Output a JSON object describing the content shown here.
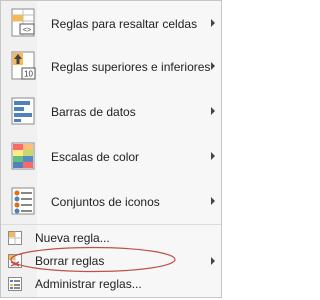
{
  "menu": {
    "items": [
      {
        "label": "Reglas para resaltar celdas",
        "icon": "highlight-cells-rules-icon",
        "has_submenu": true
      },
      {
        "label": "Reglas superiores e inferiores",
        "icon": "top-bottom-rules-icon",
        "has_submenu": true
      },
      {
        "label": "Barras de datos",
        "icon": "data-bars-icon",
        "has_submenu": true
      },
      {
        "label": "Escalas de color",
        "icon": "color-scales-icon",
        "has_submenu": true
      },
      {
        "label": "Conjuntos de iconos",
        "icon": "icon-sets-icon",
        "has_submenu": true
      }
    ],
    "commands": [
      {
        "label": "Nueva regla...",
        "icon": "new-rule-icon",
        "has_submenu": false
      },
      {
        "label": "Borrar reglas",
        "icon": "clear-rules-icon",
        "has_submenu": true
      },
      {
        "label": "Administrar reglas...",
        "icon": "manage-rules-icon",
        "has_submenu": false
      }
    ],
    "top_rules_icon_number": "10",
    "highlight_icon_glyph": "<>",
    "highlight_color": "#c0504d"
  }
}
